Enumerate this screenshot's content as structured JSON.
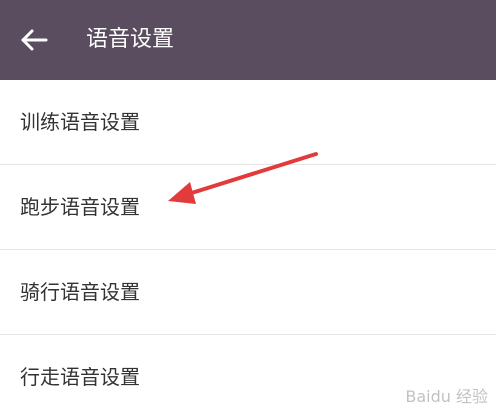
{
  "header": {
    "title": "语音设置",
    "back_icon": "back-arrow-icon",
    "background_color": "#5a4d5f"
  },
  "list": {
    "items": [
      {
        "label": "训练语音设置"
      },
      {
        "label": "跑步语音设置"
      },
      {
        "label": "骑行语音设置"
      },
      {
        "label": "行走语音设置"
      }
    ]
  },
  "annotation": {
    "type": "red-arrow",
    "target": "跑步语音设置",
    "color": "#e23b3b"
  },
  "watermark": {
    "text": "Baidu 经验"
  }
}
